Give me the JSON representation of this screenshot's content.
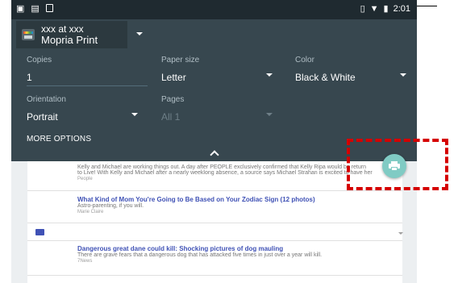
{
  "status_bar": {
    "time": "2:01",
    "left_icons": [
      "image-icon",
      "screenshot-icon",
      "sd-card-icon"
    ],
    "right_icons": [
      "vibrate-icon",
      "wifi-icon",
      "battery-icon"
    ]
  },
  "printer": {
    "account": "xxx at xxx",
    "name": "Mopria Print"
  },
  "options": {
    "copies": {
      "label": "Copies",
      "value": "1"
    },
    "paper_size": {
      "label": "Paper size",
      "value": "Letter"
    },
    "color": {
      "label": "Color",
      "value": "Black & White"
    },
    "orientation": {
      "label": "Orientation",
      "value": "Portrait"
    },
    "pages": {
      "label": "Pages",
      "value": "All 1"
    },
    "more_options": "MORE OPTIONS"
  },
  "feed": {
    "partial_lines": [
      "Kelly and Michael are working things out. A day after PEOPLE exclusively confirmed that Kelly Ripa would be return",
      "to Live! With Kelly and Michael after a nearly weeklong absence, a source says Michael Strahan is excited to have her",
      "People"
    ],
    "articles": [
      {
        "title": "What Kind of Mom You're Going to Be Based on Your Zodiac Sign (12 photos)",
        "subtitle": "Astro-parenting, if you will.",
        "source": "Marie Claire"
      },
      {
        "title": "Dangerous great dane could kill: Shocking pictures of dog mauling",
        "subtitle": "There are grave fears that a dangerous dog that has attacked five times in just over a year will kill.",
        "source": "7News"
      }
    ]
  },
  "colors": {
    "panel": "#37474f",
    "status_bar": "#1f2a30",
    "fab": "#80cbc4",
    "highlight": "#d50000",
    "link": "#3f51b5"
  }
}
